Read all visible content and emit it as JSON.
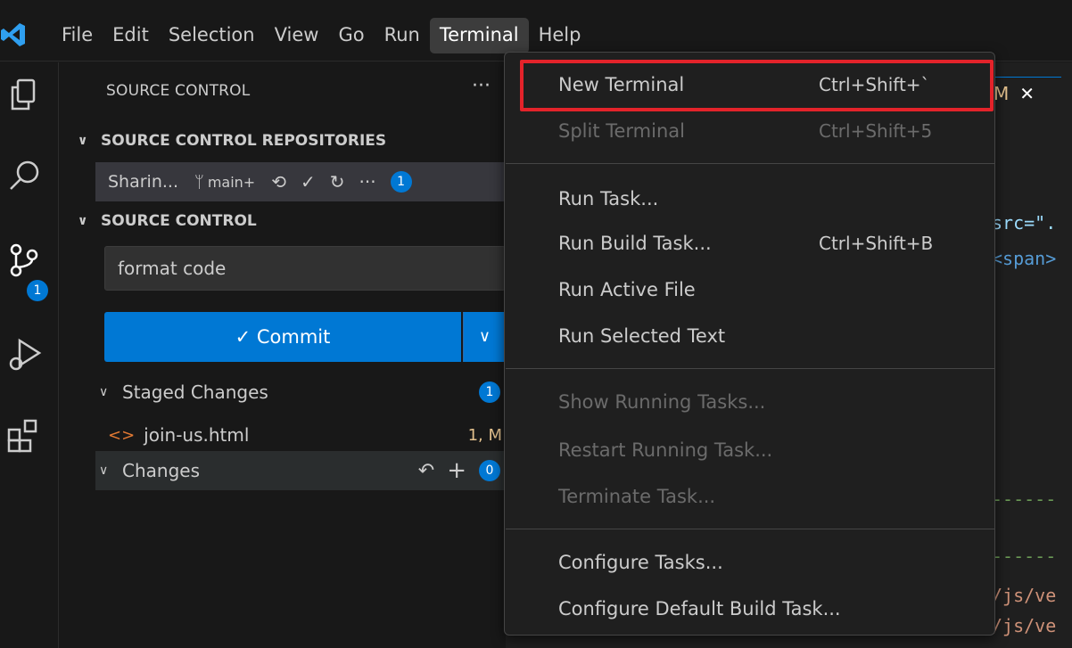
{
  "menubar": {
    "items": [
      "File",
      "Edit",
      "Selection",
      "View",
      "Go",
      "Run",
      "Terminal",
      "Help"
    ],
    "active": "Terminal"
  },
  "activitybar": {
    "scm_badge": "1"
  },
  "sidebar": {
    "title": "SOURCE CONTROL",
    "more": "···",
    "repositories_header": "SOURCE CONTROL REPOSITORIES",
    "repo": {
      "name": "Sharin...",
      "branch": "main+",
      "badge": "1"
    },
    "scm_header": "SOURCE CONTROL",
    "message_value": "format code",
    "commit_label": "✓ Commit",
    "staged": {
      "label": "Staged Changes",
      "count": "1"
    },
    "file": {
      "name": "join-us.html",
      "status": "1, M"
    },
    "changes": {
      "label": "Changes",
      "count": "0"
    }
  },
  "editor": {
    "tab_status": "M",
    "code_lines": [
      "src=\".",
      "<span>",
      "------",
      "------",
      "/js/ve",
      "/js/ve"
    ]
  },
  "terminal_menu": {
    "items": [
      {
        "label": "New Terminal",
        "shortcut": "Ctrl+Shift+`",
        "enabled": true
      },
      {
        "label": "Split Terminal",
        "shortcut": "Ctrl+Shift+5",
        "enabled": false
      },
      {
        "label": "Run Task...",
        "shortcut": "",
        "enabled": true
      },
      {
        "label": "Run Build Task...",
        "shortcut": "Ctrl+Shift+B",
        "enabled": true
      },
      {
        "label": "Run Active File",
        "shortcut": "",
        "enabled": true
      },
      {
        "label": "Run Selected Text",
        "shortcut": "",
        "enabled": true
      },
      {
        "label": "Show Running Tasks...",
        "shortcut": "",
        "enabled": false
      },
      {
        "label": "Restart Running Task...",
        "shortcut": "",
        "enabled": false
      },
      {
        "label": "Terminate Task...",
        "shortcut": "",
        "enabled": false
      },
      {
        "label": "Configure Tasks...",
        "shortcut": "",
        "enabled": true
      },
      {
        "label": "Configure Default Build Task...",
        "shortcut": "",
        "enabled": true
      }
    ]
  },
  "colors": {
    "accent": "#0078d4",
    "highlight_box": "#e3232a",
    "modified": "#e2c08d"
  }
}
